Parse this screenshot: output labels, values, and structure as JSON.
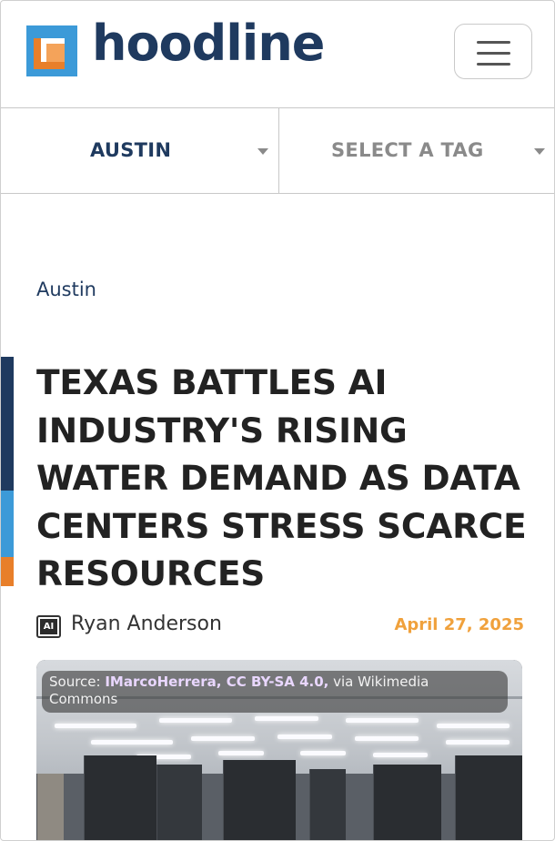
{
  "header": {
    "logo_text": "hoodline",
    "menu_icon": "hamburger-menu-icon"
  },
  "selectors": {
    "city": "AUSTIN",
    "tag": "SELECT A TAG"
  },
  "article": {
    "category": "Austin",
    "headline": "TEXAS BATTLES AI INDUSTRY'S RISING WATER DEMAND AS DATA CENTERS STRESS SCARCE RESOURCES",
    "author_icon": "ai-chip-icon",
    "author_icon_text": "AI",
    "author": "Ryan Anderson",
    "date": "April 27, 2025",
    "image_caption": {
      "prefix": "Source: ",
      "credit": "IMarcoHerrera, CC BY-SA 4.0,",
      "suffix": " via Wikimedia Commons"
    }
  },
  "colors": {
    "brand_navy": "#1f3a5f",
    "brand_blue": "#3c9ad8",
    "brand_orange": "#e87f2a",
    "date_orange": "#f0a13c"
  }
}
